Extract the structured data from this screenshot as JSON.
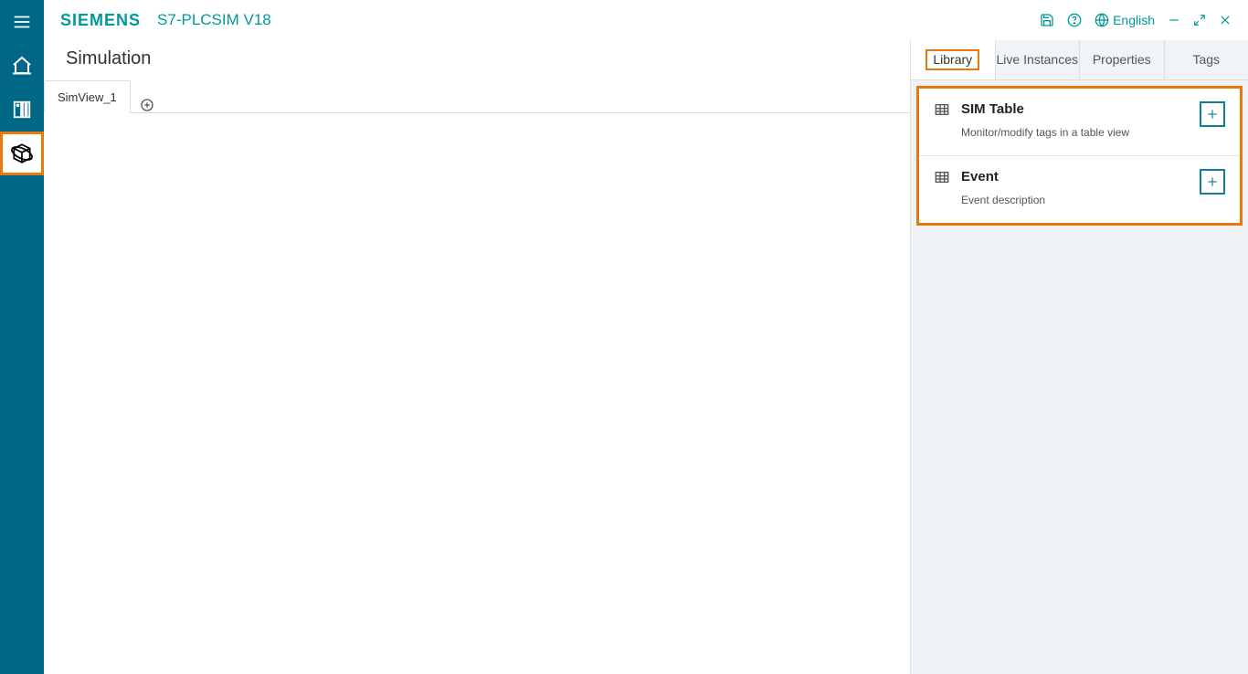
{
  "brand": "SIEMENS",
  "app_title": "S7-PLCSIM V18",
  "topbar": {
    "language": "English"
  },
  "rail": {
    "items": [
      "menu",
      "home",
      "module",
      "sim3d"
    ]
  },
  "simulation": {
    "title": "Simulation",
    "tabs": [
      "SimView_1"
    ]
  },
  "rightpanel": {
    "tabs": {
      "library": "Library",
      "live": "Live Instances",
      "properties": "Properties",
      "tags": "Tags"
    },
    "library": {
      "sim_table": {
        "title": "SIM Table",
        "desc": "Monitor/modify tags in a table view"
      },
      "event": {
        "title": "Event",
        "desc": "Event description"
      }
    }
  }
}
